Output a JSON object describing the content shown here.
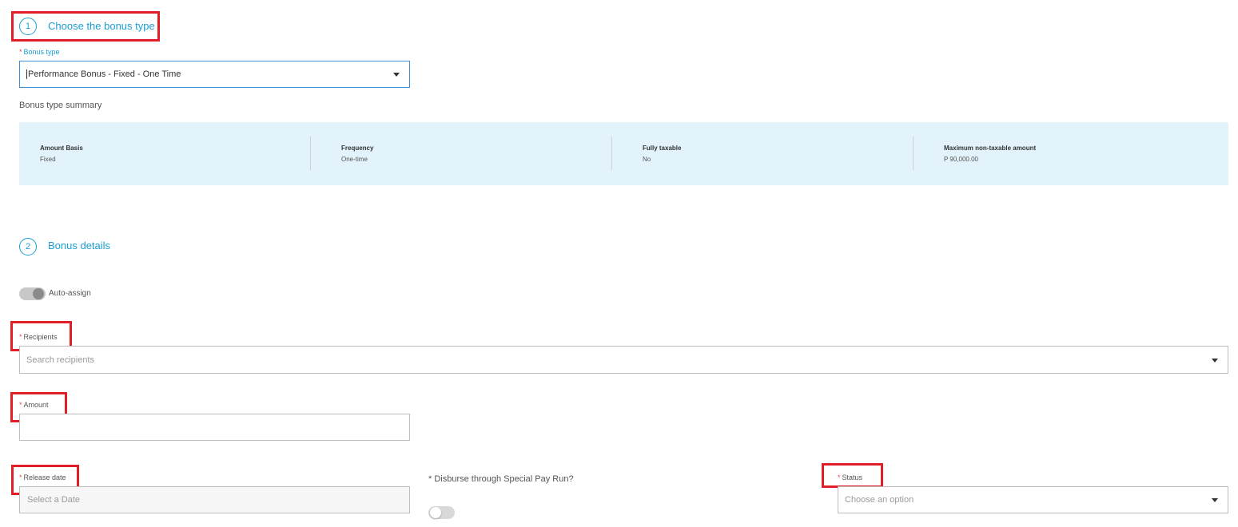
{
  "step1": {
    "number": "1",
    "title": "Choose the bonus type"
  },
  "bonus_type": {
    "label": "Bonus type",
    "required_mark": "*",
    "value": "Performance Bonus - Fixed - One Time"
  },
  "summary": {
    "heading": "Bonus type summary",
    "items": [
      {
        "title": "Amount Basis",
        "value": "Fixed"
      },
      {
        "title": "Frequency",
        "value": "One-time"
      },
      {
        "title": "Fully taxable",
        "value": "No"
      },
      {
        "title": "Maximum non-taxable amount",
        "value": "P 90,000.00"
      }
    ]
  },
  "step2": {
    "number": "2",
    "title": "Bonus details"
  },
  "auto_assign": {
    "label": "Auto-assign"
  },
  "recipients": {
    "label": "Recipients",
    "required_mark": "*",
    "placeholder": "Search recipients"
  },
  "amount": {
    "label": "Amount",
    "required_mark": "*",
    "value": ""
  },
  "release_date": {
    "label": "Release date",
    "required_mark": "*",
    "placeholder": "Select a Date"
  },
  "special_pay_run": {
    "label": "* Disburse through Special Pay Run?"
  },
  "status": {
    "label": "Status",
    "required_mark": "*",
    "placeholder": "Choose an option"
  },
  "colors": {
    "accent": "#1a9fd4",
    "highlight_box": "#e21f26",
    "summary_bg": "#e3f3fb",
    "required": "#e34b4b"
  }
}
